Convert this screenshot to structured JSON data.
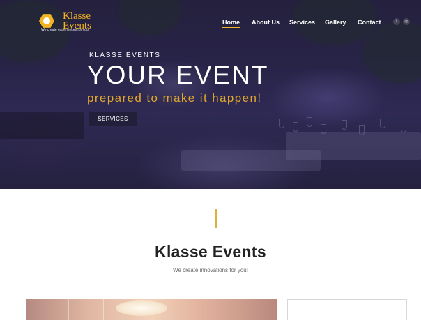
{
  "brand": {
    "name_line1": "Klasse",
    "name_line2": "Events",
    "tagline": "We create experiences for you",
    "accent_color": "#f3b424"
  },
  "nav": {
    "items": [
      {
        "label": "Home",
        "active": true
      },
      {
        "label": "About Us",
        "active": false
      },
      {
        "label": "Services",
        "active": false
      },
      {
        "label": "Gallery",
        "active": false
      },
      {
        "label": "Contact",
        "active": false
      }
    ],
    "social": [
      {
        "icon": "facebook-icon",
        "glyph": "f"
      },
      {
        "icon": "instagram-icon",
        "glyph": "◎"
      }
    ]
  },
  "hero": {
    "kicker": "KLASSE EVENTS",
    "headline": "YOUR EVENT",
    "subline": "prepared to make it happen!",
    "button_label": "SERVICES"
  },
  "section": {
    "title": "Klasse Events",
    "subtitle": "We create innovations for you!"
  }
}
